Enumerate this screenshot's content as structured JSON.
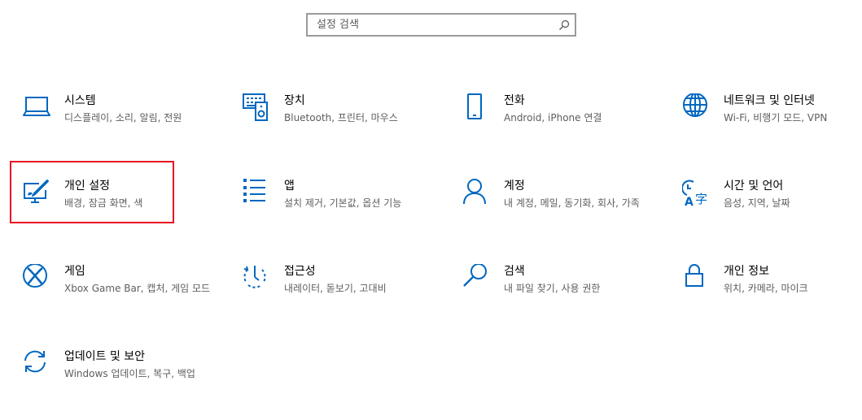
{
  "search": {
    "placeholder": "설정 검색",
    "icon": "search-icon"
  },
  "accent": "#0067c0",
  "highlight_color": "#e81123",
  "tiles": [
    {
      "id": "system",
      "title": "시스템",
      "desc": "디스플레이, 소리, 알림, 전원",
      "icon": "laptop-icon"
    },
    {
      "id": "devices",
      "title": "장치",
      "desc": "Bluetooth, 프린터, 마우스",
      "icon": "keyboard-speaker-icon"
    },
    {
      "id": "phone",
      "title": "전화",
      "desc": "Android, iPhone 연결",
      "icon": "phone-icon"
    },
    {
      "id": "network",
      "title": "네트워크 및 인터넷",
      "desc": "Wi-Fi, 비행기 모드, VPN",
      "icon": "globe-icon"
    },
    {
      "id": "personalization",
      "title": "개인 설정",
      "desc": "배경, 잠금 화면, 색",
      "icon": "personalization-icon"
    },
    {
      "id": "apps",
      "title": "앱",
      "desc": "설치 제거, 기본값, 옵션 기능",
      "icon": "apps-list-icon"
    },
    {
      "id": "accounts",
      "title": "계정",
      "desc": "내 계정, 메일, 동기화, 회사, 가족",
      "icon": "person-icon"
    },
    {
      "id": "time",
      "title": "시간 및 언어",
      "desc": "음성, 지역, 날짜",
      "icon": "time-language-icon"
    },
    {
      "id": "gaming",
      "title": "게임",
      "desc": "Xbox Game Bar, 캡처, 게임 모드",
      "icon": "xbox-icon"
    },
    {
      "id": "ease",
      "title": "접근성",
      "desc": "내레이터, 돋보기, 고대비",
      "icon": "ease-of-access-icon"
    },
    {
      "id": "search",
      "title": "검색",
      "desc": "내 파일 찾기, 사용 권한",
      "icon": "magnifier-icon"
    },
    {
      "id": "privacy",
      "title": "개인 정보",
      "desc": "위치, 카메라, 마이크",
      "icon": "lock-icon"
    },
    {
      "id": "update",
      "title": "업데이트 및 보안",
      "desc": "Windows 업데이트, 복구, 백업",
      "icon": "sync-icon"
    }
  ]
}
